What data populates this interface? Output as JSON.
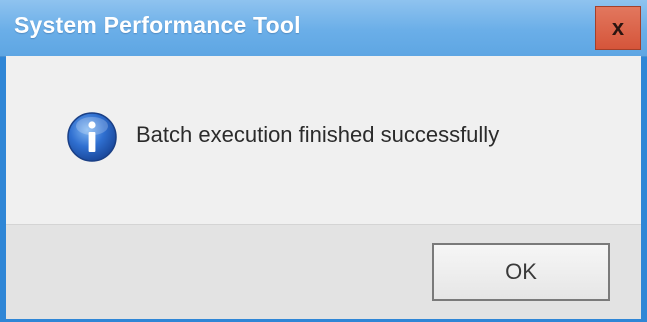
{
  "window": {
    "title": "System Performance Tool",
    "close_label": "x"
  },
  "dialog": {
    "icon": "info-icon",
    "message": "Batch execution finished successfully"
  },
  "buttons": {
    "ok_label": "OK"
  },
  "colors": {
    "titlebar": "#6aaee8",
    "close_button": "#d5553a",
    "window_border": "#2f86d6",
    "body_background": "#f0f0f0",
    "footer_background": "#e3e3e3"
  }
}
